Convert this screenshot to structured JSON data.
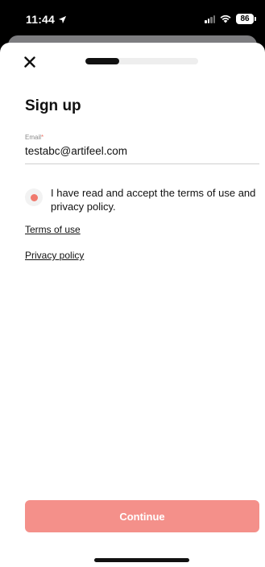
{
  "status_bar": {
    "time": "11:44",
    "battery": "86",
    "icons": [
      "location-arrow-icon",
      "signal-icon",
      "wifi-icon",
      "battery-icon"
    ]
  },
  "header": {
    "close_icon": "close-icon",
    "progress_fraction": 0.3
  },
  "form": {
    "title": "Sign up",
    "email": {
      "label": "Email",
      "required_marker": "*",
      "value": "testabc@artifeel.com"
    },
    "consent": {
      "text": "I have read and accept the terms of use and privacy policy."
    },
    "terms_link": "Terms of use",
    "privacy_link": "Privacy policy",
    "continue_label": "Continue"
  },
  "colors": {
    "accent": "#f07a6e",
    "button": "#f4908a",
    "text": "#111111"
  }
}
